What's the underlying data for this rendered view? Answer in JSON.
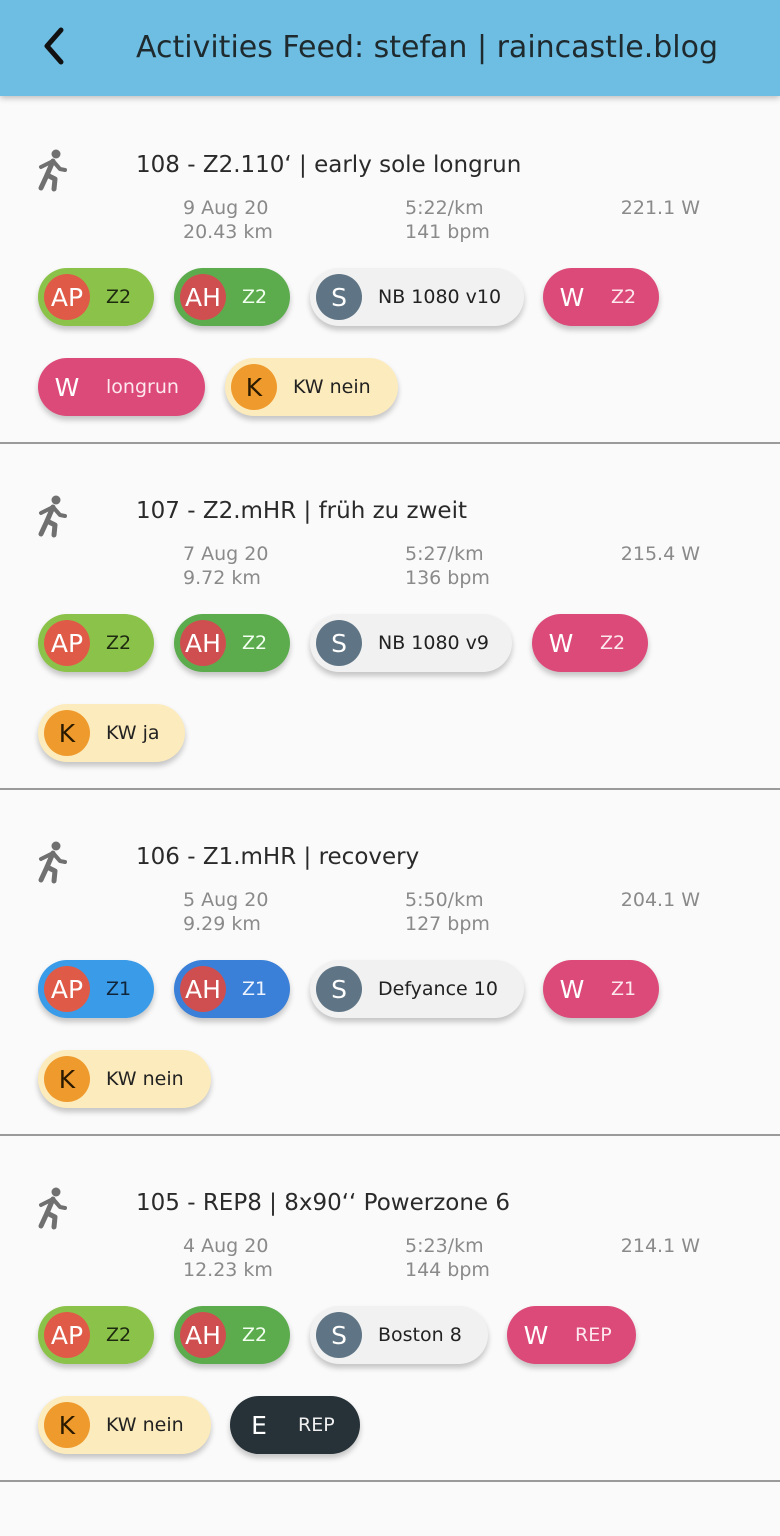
{
  "header": {
    "title": "Activities Feed: stefan | raincastle.blog"
  },
  "activities": [
    {
      "title": "108 - Z2.110‘ | early sole longrun",
      "date": "9 Aug 20",
      "distance": "20.43 km",
      "pace": "5:22/km",
      "hr": "141 bpm",
      "power": "221.1 W",
      "chips": [
        {
          "avatar": "AP",
          "label": "Z2"
        },
        {
          "avatar": "AH",
          "label": "Z2"
        },
        {
          "avatar": "S",
          "label": "NB 1080 v10"
        },
        {
          "avatar": "W",
          "label": "Z2"
        },
        {
          "avatar": "W",
          "label": "longrun"
        },
        {
          "avatar": "K",
          "label": "KW nein"
        }
      ]
    },
    {
      "title": "107 - Z2.mHR | früh zu zweit",
      "date": "7 Aug 20",
      "distance": "9.72 km",
      "pace": "5:27/km",
      "hr": "136 bpm",
      "power": "215.4 W",
      "chips": [
        {
          "avatar": "AP",
          "label": "Z2"
        },
        {
          "avatar": "AH",
          "label": "Z2"
        },
        {
          "avatar": "S",
          "label": "NB 1080 v9"
        },
        {
          "avatar": "W",
          "label": "Z2"
        },
        {
          "avatar": "K",
          "label": "KW ja"
        }
      ]
    },
    {
      "title": "106 - Z1.mHR | recovery",
      "date": "5 Aug 20",
      "distance": "9.29 km",
      "pace": "5:50/km",
      "hr": "127 bpm",
      "power": "204.1 W",
      "chips": [
        {
          "avatar": "AP",
          "label": "Z1"
        },
        {
          "avatar": "AH",
          "label": "Z1"
        },
        {
          "avatar": "S",
          "label": "Defyance 10"
        },
        {
          "avatar": "W",
          "label": "Z1"
        },
        {
          "avatar": "K",
          "label": "KW nein"
        }
      ]
    },
    {
      "title": "105 - REP8 | 8x90‘‘ Powerzone 6",
      "date": "4 Aug 20",
      "distance": "12.23 km",
      "pace": "5:23/km",
      "hr": "144 bpm",
      "power": "214.1 W",
      "chips": [
        {
          "avatar": "AP",
          "label": "Z2"
        },
        {
          "avatar": "AH",
          "label": "Z2"
        },
        {
          "avatar": "S",
          "label": "Boston 8"
        },
        {
          "avatar": "W",
          "label": "REP"
        },
        {
          "avatar": "K",
          "label": "KW nein"
        },
        {
          "avatar": "E",
          "label": "REP"
        }
      ]
    }
  ]
}
